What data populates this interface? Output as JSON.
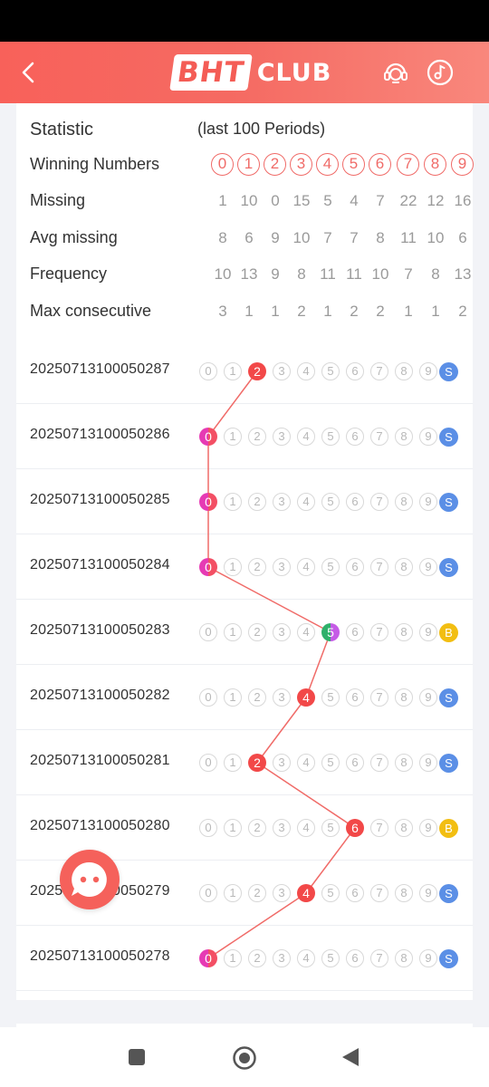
{
  "header": {
    "logo_box": "BHT",
    "logo_text": "CLUB"
  },
  "statistics": {
    "title": "Statistic",
    "subtitle": "(last 100 Periods)",
    "winning_numbers_label": "Winning Numbers",
    "winning_numbers": [
      "0",
      "1",
      "2",
      "3",
      "4",
      "5",
      "6",
      "7",
      "8",
      "9"
    ],
    "rows": [
      {
        "label": "Missing",
        "values": [
          "1",
          "10",
          "0",
          "15",
          "5",
          "4",
          "7",
          "22",
          "12",
          "16"
        ]
      },
      {
        "label": "Avg missing",
        "values": [
          "8",
          "6",
          "9",
          "10",
          "7",
          "7",
          "8",
          "11",
          "10",
          "6"
        ]
      },
      {
        "label": "Frequency",
        "values": [
          "10",
          "13",
          "9",
          "8",
          "11",
          "11",
          "10",
          "7",
          "8",
          "13"
        ]
      },
      {
        "label": "Max consecutive",
        "values": [
          "3",
          "1",
          "1",
          "2",
          "1",
          "2",
          "2",
          "1",
          "1",
          "2"
        ]
      }
    ]
  },
  "draws": [
    {
      "period": "20250713100050287",
      "number": 2,
      "size": "S"
    },
    {
      "period": "20250713100050286",
      "number": 0,
      "size": "S"
    },
    {
      "period": "20250713100050285",
      "number": 0,
      "size": "S"
    },
    {
      "period": "20250713100050284",
      "number": 0,
      "size": "S"
    },
    {
      "period": "20250713100050283",
      "number": 5,
      "size": "B"
    },
    {
      "period": "20250713100050282",
      "number": 4,
      "size": "S"
    },
    {
      "period": "20250713100050281",
      "number": 2,
      "size": "S"
    },
    {
      "period": "20250713100050280",
      "number": 6,
      "size": "B"
    },
    {
      "period": "20250713100050279",
      "number": 4,
      "size": "S"
    },
    {
      "period": "20250713100050278",
      "number": 0,
      "size": "S"
    }
  ],
  "colors": {
    "accent": "#f8615a",
    "hit_red": "#f24848",
    "small_badge": "#5b8fe6",
    "big_badge": "#f2be12",
    "trend_line": "#f06b68"
  },
  "icons": {
    "back": "back-arrow-icon",
    "support": "customer-service-icon",
    "music": "music-note-icon",
    "chat": "chat-bubble-icon"
  }
}
